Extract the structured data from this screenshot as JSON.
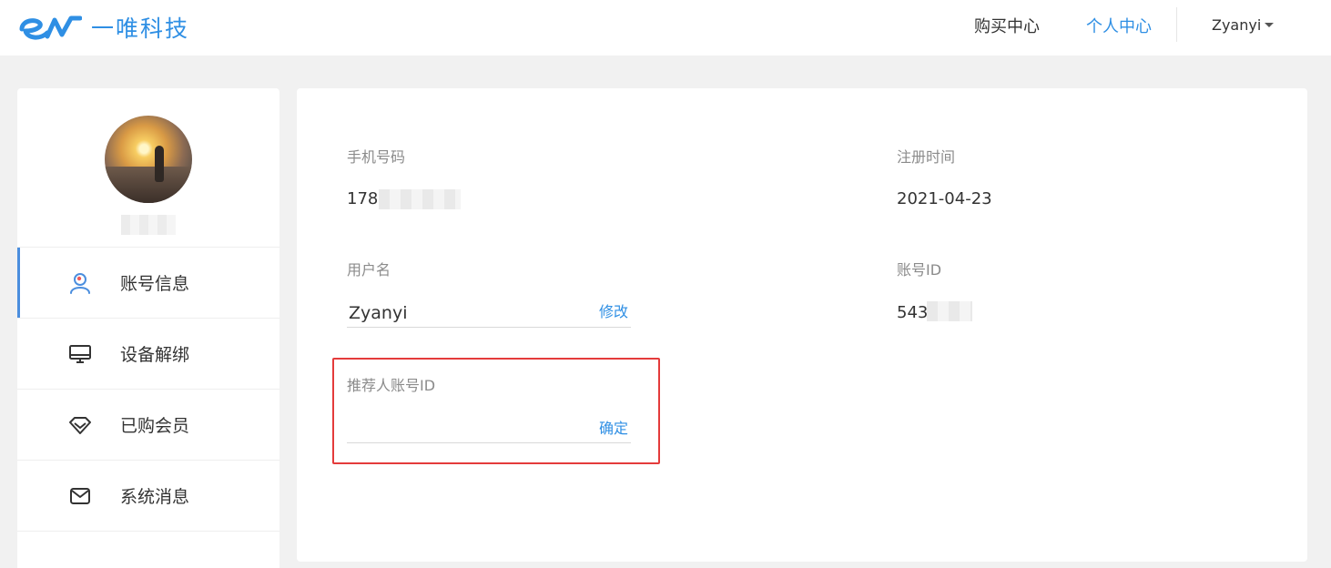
{
  "brand": {
    "name": "一唯科技",
    "logo_icon": "en-logo-icon",
    "accent": "#2f8fe4"
  },
  "nav": {
    "items": [
      {
        "label": "购买中心",
        "active": false
      },
      {
        "label": "个人中心",
        "active": true
      }
    ],
    "user": "Zyanyi"
  },
  "sidebar": {
    "menu": [
      {
        "label": "账号信息",
        "icon": "user-icon",
        "active": true
      },
      {
        "label": "设备解绑",
        "icon": "monitor-icon",
        "active": false
      },
      {
        "label": "已购会员",
        "icon": "diamond-icon",
        "active": false
      },
      {
        "label": "系统消息",
        "icon": "mail-icon",
        "active": false
      }
    ]
  },
  "account": {
    "phone": {
      "label": "手机号码",
      "value": "178"
    },
    "register_time": {
      "label": "注册时间",
      "value": "2021-04-23"
    },
    "username": {
      "label": "用户名",
      "value": "Zyanyi",
      "action": "修改"
    },
    "account_id": {
      "label": "账号ID",
      "value": "543"
    },
    "referrer": {
      "label": "推荐人账号ID",
      "value": "",
      "action": "确定"
    }
  },
  "highlight_color": "#e43b3b"
}
